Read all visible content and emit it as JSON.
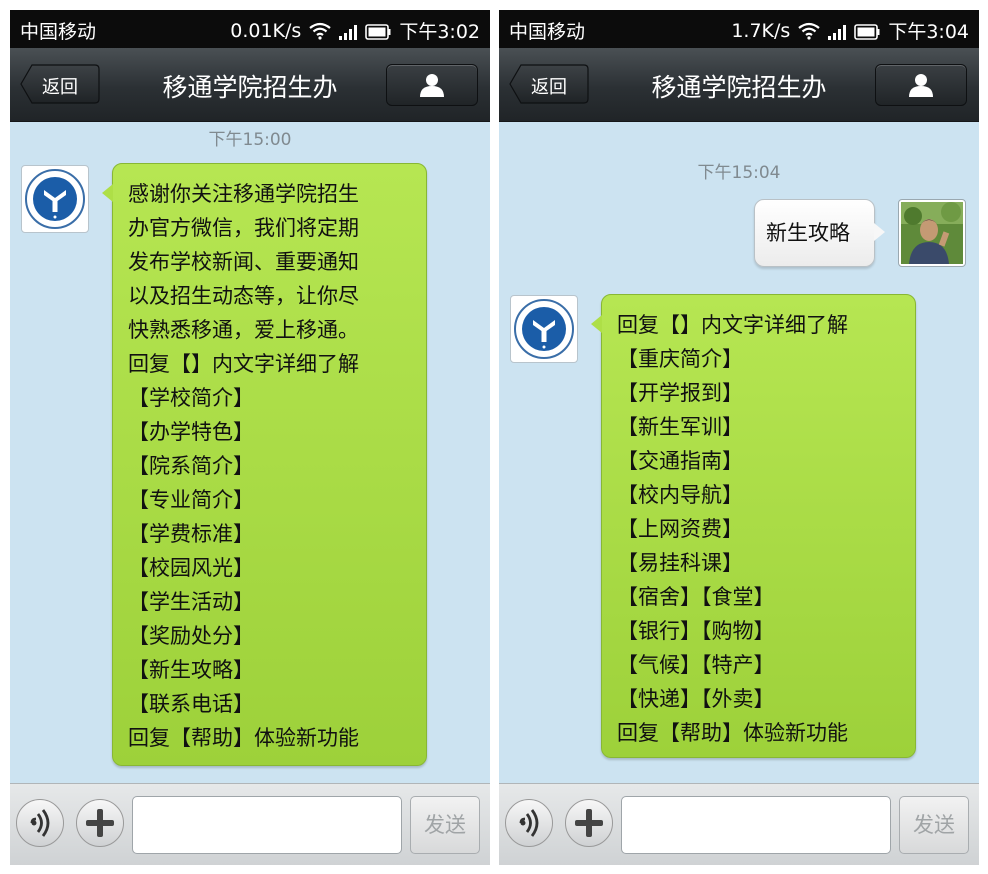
{
  "left": {
    "status": {
      "carrier": "中国移动",
      "speed": "0.01K/s",
      "time": "下午3:02"
    },
    "nav": {
      "back_label": "返回",
      "title": "移通学院招生办"
    },
    "timestamp": "下午15:00",
    "message_lines": [
      "感谢你关注移通学院招生",
      "办官方微信，我们将定期",
      "发布学校新闻、重要通知",
      "以及招生动态等，让你尽",
      "快熟悉移通，爱上移通。",
      "回复【】内文字详细了解",
      "【学校简介】",
      "【办学特色】",
      "【院系简介】",
      "【专业简介】",
      "【学费标准】",
      "【校园风光】",
      "【学生活动】",
      "【奖励处分】",
      "【新生攻略】",
      "【联系电话】",
      "回复【帮助】体验新功能"
    ],
    "input": {
      "placeholder": "",
      "send_label": "发送"
    }
  },
  "right": {
    "status": {
      "carrier": "中国移动",
      "speed": "1.7K/s",
      "time": "下午3:04"
    },
    "nav": {
      "back_label": "返回",
      "title": "移通学院招生办"
    },
    "timestamp": "下午15:04",
    "sent_message": "新生攻略",
    "message_lines": [
      "回复【】内文字详细了解",
      "【重庆简介】",
      "【开学报到】",
      "【新生军训】",
      "【交通指南】",
      "【校内导航】",
      "【上网资费】",
      "【易挂科课】",
      "【宿舍】【食堂】",
      "【银行】【购物】",
      "【气候】【特产】",
      "【快递】【外卖】",
      "回复【帮助】体验新功能"
    ],
    "input": {
      "placeholder": "",
      "send_label": "发送"
    }
  },
  "icons": {
    "wifi": "wifi-icon",
    "signal": "signal-icon",
    "battery": "battery-icon",
    "profile": "person-icon",
    "voice": "voice-icon",
    "plus": "plus-icon",
    "school_logo": "school-logo-icon",
    "user_avatar": "user-avatar-photo"
  },
  "colors": {
    "chat_background": "#cce3f1",
    "received_bubble": "#a8dc44",
    "sent_bubble": "#f4f4f4",
    "nav_bar": "#2b3034",
    "status_bar": "#0c0c0c"
  }
}
